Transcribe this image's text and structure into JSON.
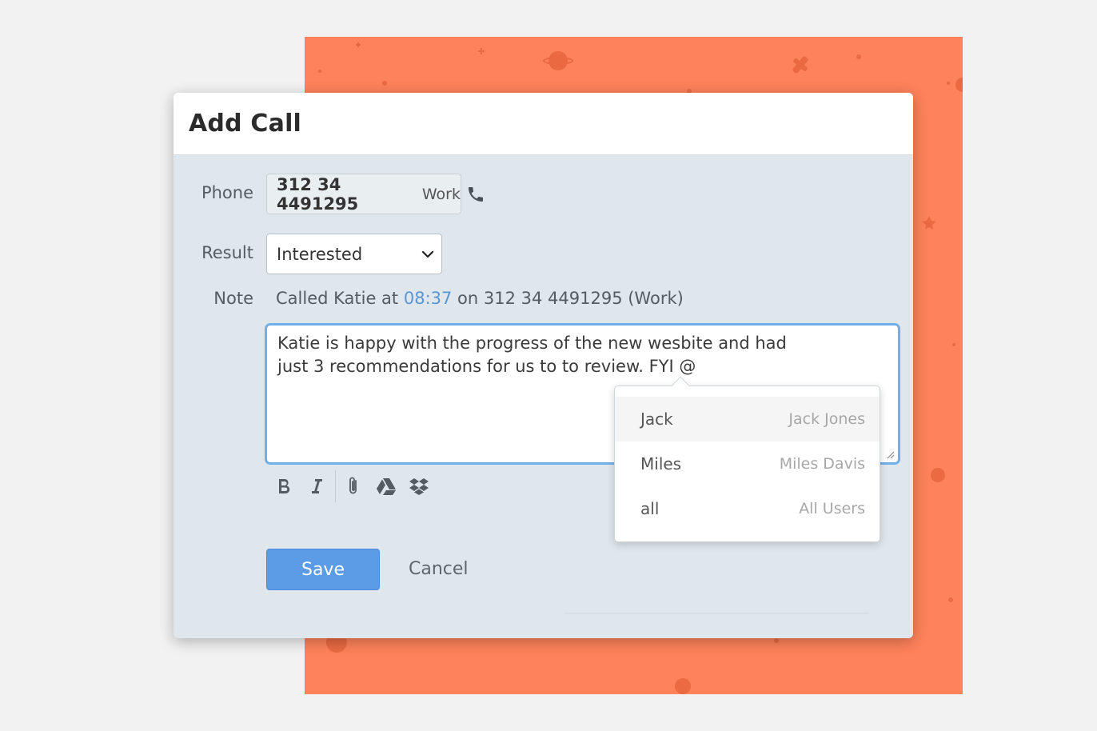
{
  "dialog": {
    "title": "Add Call",
    "phone": {
      "label": "Phone",
      "number": "312 34 4491295",
      "type": "Work",
      "icon": "phone-icon"
    },
    "result": {
      "label": "Result",
      "selected": "Interested"
    },
    "note": {
      "label": "Note",
      "summary_prefix": "Called Katie at ",
      "summary_time": "08:37",
      "summary_suffix": " on 312 34 4491295 (Work)",
      "text_line1": "Katie is happy with the progress of the new wesbite and had",
      "text_line2": "just 3 recommendations for us to to review. FYI @"
    },
    "toolbar": {
      "icons": [
        "bold-icon",
        "italic-icon",
        "paperclip-icon",
        "google-drive-icon",
        "dropbox-icon"
      ]
    },
    "actions": {
      "save_label": "Save",
      "cancel_label": "Cancel"
    }
  },
  "mention_popup": {
    "items": [
      {
        "handle": "Jack",
        "name": "Jack Jones"
      },
      {
        "handle": "Miles",
        "name": "Miles Davis"
      },
      {
        "handle": "all",
        "name": "All Users"
      }
    ]
  },
  "colors": {
    "background_accent": "#fe825a",
    "primary_button": "#5c9ce6",
    "link_time": "#5a95d4",
    "focus_border": "#6fb0ea"
  }
}
